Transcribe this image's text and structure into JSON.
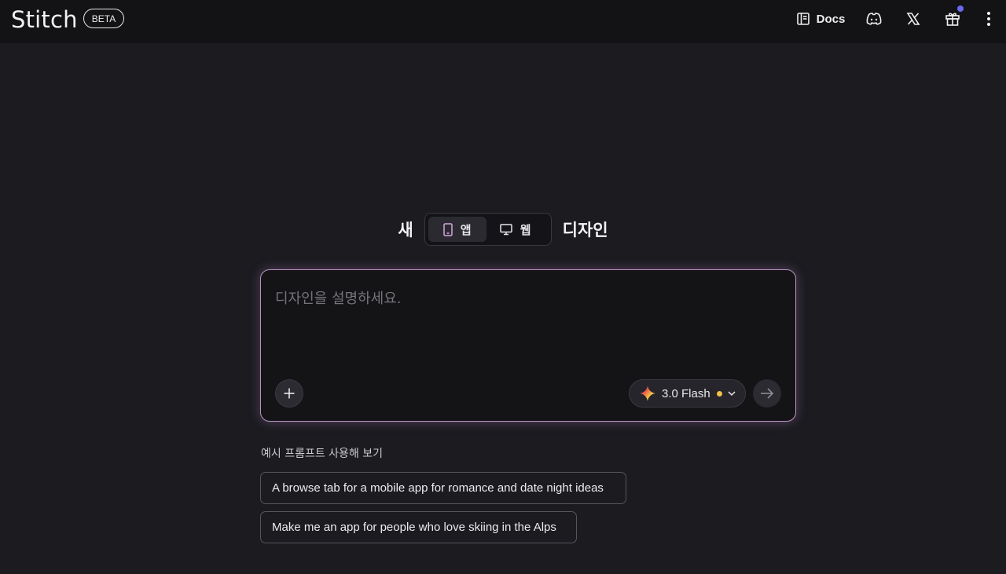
{
  "header": {
    "logo": "Stitch",
    "badge": "BETA",
    "docs_label": "Docs",
    "icons": [
      "docs-icon",
      "discord-icon",
      "x-logo-icon",
      "gift-icon",
      "more-vertical-icon"
    ],
    "notification_color": "#6c68f0"
  },
  "hero": {
    "word_before": "새",
    "word_after": "디자인",
    "segments": [
      {
        "label": "앱",
        "icon": "mobile-icon",
        "active": true
      },
      {
        "label": "웹",
        "icon": "desktop-icon",
        "active": false
      }
    ]
  },
  "prompt": {
    "placeholder": "디자인을 설명하세요.",
    "value": "",
    "model_label": "3.0 Flash",
    "border_color": "#b894c4",
    "model_dot_color": "#f3c14a"
  },
  "examples": {
    "title": "예시 프롬프트 사용해 보기",
    "items": [
      "A browse tab for a mobile app for romance and date night ideas",
      "Make me an app for people who love skiing in the Alps"
    ]
  }
}
